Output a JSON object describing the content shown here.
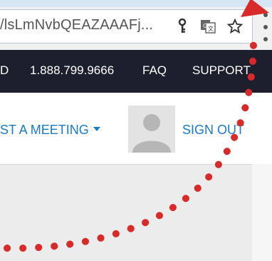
{
  "browser": {
    "url": "/lsLmNvbQEAZAAAFj...",
    "icons": [
      "key-icon",
      "translate-icon",
      "star-icon",
      "menu-icon"
    ]
  },
  "nav": {
    "items": [
      {
        "label": "D"
      },
      {
        "label": "1.888.799.9666"
      },
      {
        "label": "FAQ"
      },
      {
        "label": "SUPPORT"
      }
    ]
  },
  "header": {
    "host_meeting_label": "ST A MEETING",
    "sign_out_label": "SIGN OUT"
  },
  "colors": {
    "nav_bg": "#1e1f2e",
    "link_blue": "#1a7acb",
    "annotation_red": "#d82a2a"
  }
}
